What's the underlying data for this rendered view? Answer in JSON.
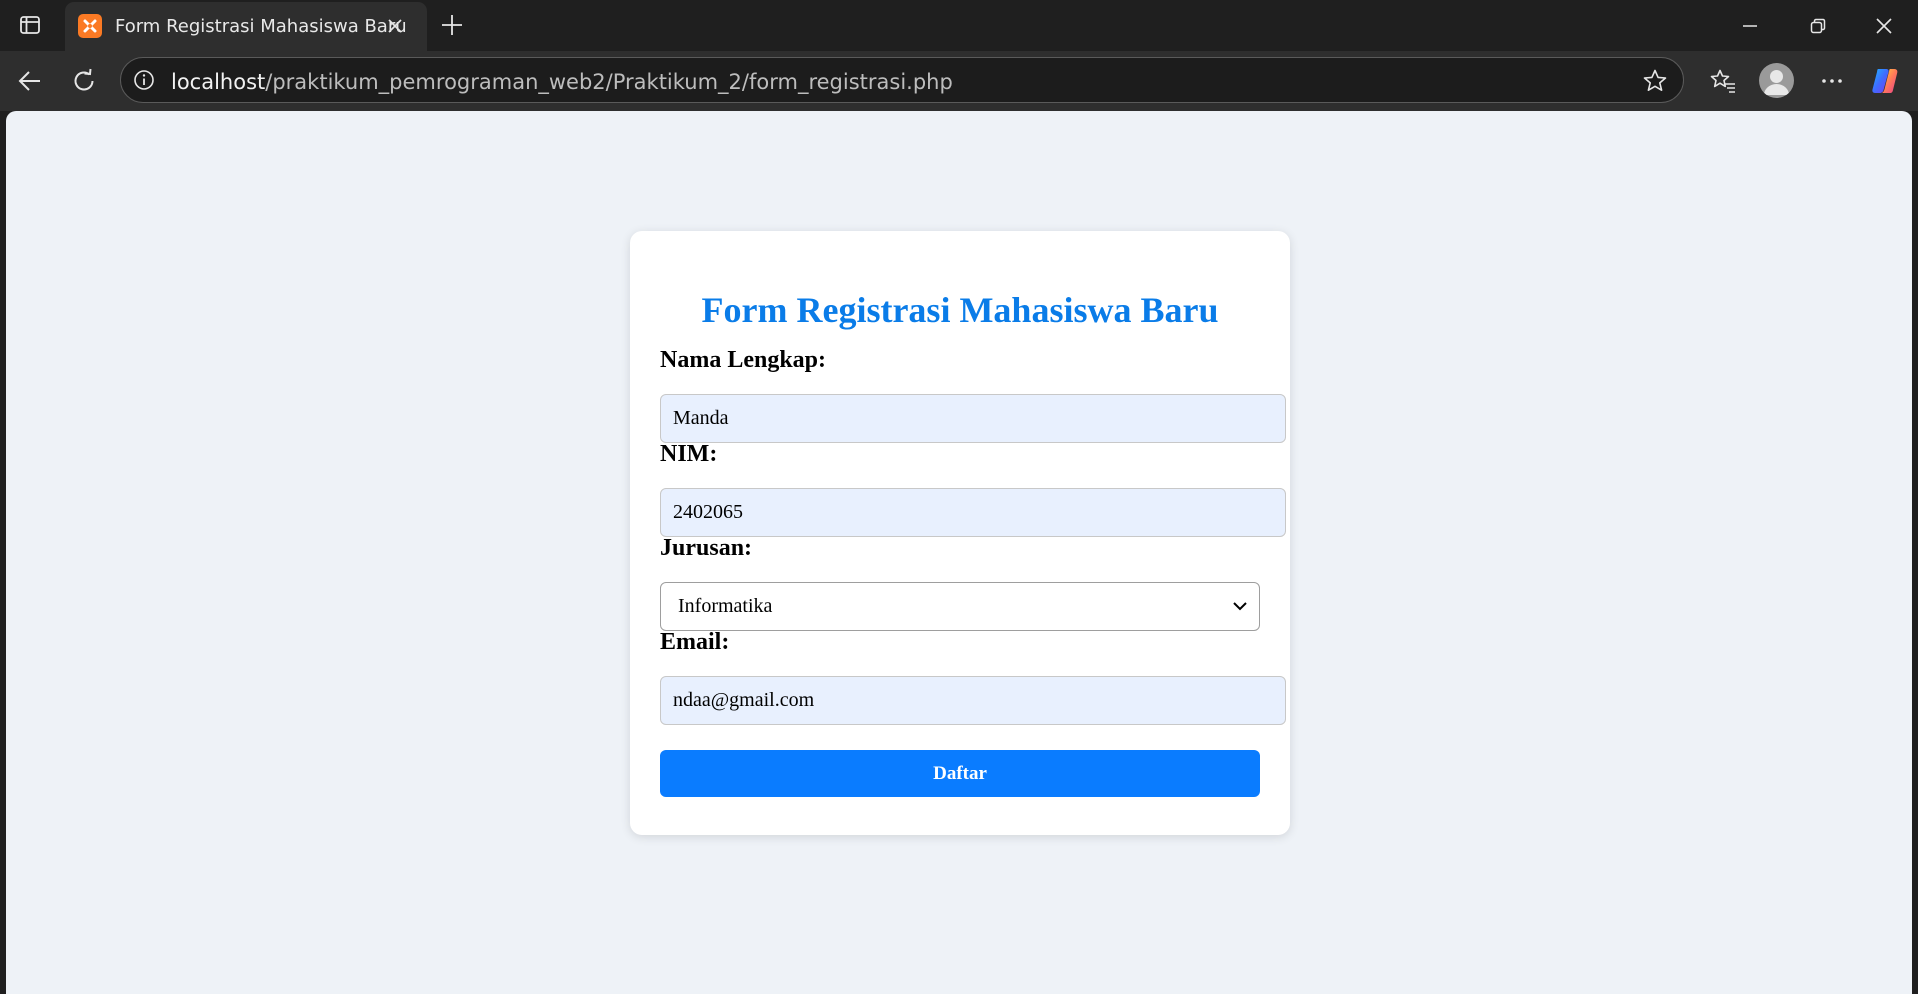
{
  "browser": {
    "tab_title": "Form Registrasi Mahasiswa Baru",
    "url_host": "localhost",
    "url_path": "/praktikum_pemrograman_web2/Praktikum_2/form_registrasi.php"
  },
  "form": {
    "title": "Form Registrasi Mahasiswa Baru",
    "nama_label": "Nama Lengkap:",
    "nama_value": "Manda",
    "nim_label": "NIM:",
    "nim_value": "2402065",
    "jurusan_label": "Jurusan:",
    "jurusan_value": "Informatika",
    "email_label": "Email:",
    "email_value": "ndaa@gmail.com",
    "submit_label": "Daftar"
  },
  "colors": {
    "accent": "#0a7cff",
    "title": "#0a7ce8",
    "page_bg": "#eef2f7",
    "autofill_bg": "#e8f0fe",
    "favicon": "#fb7a24"
  },
  "icons": {
    "tab_actions": "tab-actions-icon",
    "favicon": "xampp-favicon-icon",
    "tab_close": "close-icon",
    "new_tab": "plus-icon",
    "minimize": "minimize-icon",
    "restore": "restore-icon",
    "close_window": "close-icon",
    "back": "arrow-left-icon",
    "reload": "reload-icon",
    "site_info": "info-icon",
    "favorite": "star-icon",
    "favorites": "favorites-icon",
    "profile": "profile-icon",
    "more": "more-icon",
    "copilot": "copilot-icon",
    "select_chevron": "chevron-down-icon"
  }
}
